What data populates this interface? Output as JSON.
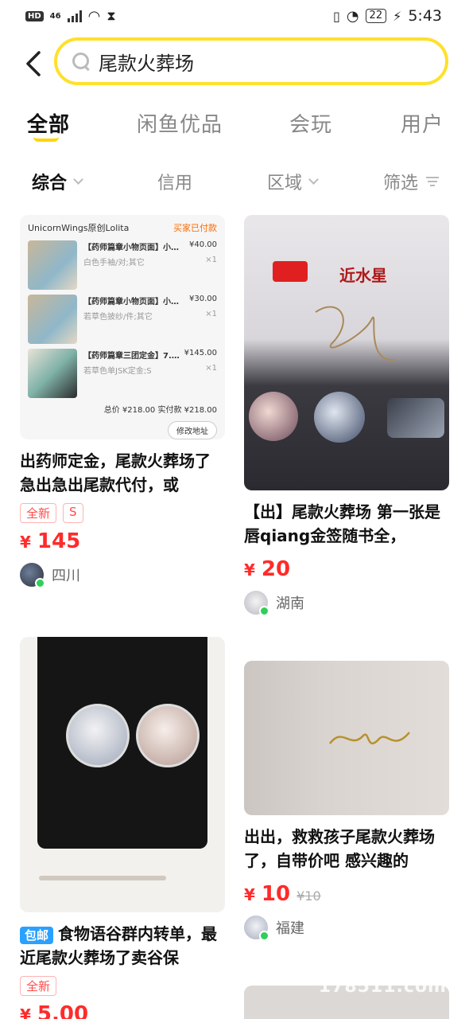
{
  "status_bar": {
    "hd": "HD",
    "network": "46",
    "battery": "22",
    "time": "5:43"
  },
  "search": {
    "back_icon": "chevron-left-icon",
    "query": "尾款火葬场",
    "border_color": "#ffe02b"
  },
  "tabs": [
    {
      "label": "全部",
      "active": true
    },
    {
      "label": "闲鱼优品",
      "active": false
    },
    {
      "label": "会玩",
      "active": false
    },
    {
      "label": "用户",
      "active": false
    }
  ],
  "filters": [
    {
      "label": "综合",
      "active": true
    },
    {
      "label": "信用",
      "active": false
    },
    {
      "label": "区域",
      "active": false
    },
    {
      "label": "筛选",
      "active": false
    }
  ],
  "cards": [
    {
      "order_shot": {
        "shop": "UnicornWings原创Lolita",
        "status": "买家已付款",
        "items": [
          {
            "name": "【药师篇章小物页面】小物/...",
            "price": "¥40.00",
            "spec": "白色手袖/对;其它",
            "qty": "×1"
          },
          {
            "name": "【药师篇章小物页面】小物/...",
            "price": "¥30.00",
            "spec": "若草色披纱/件;其它",
            "qty": "×1"
          },
          {
            "name": "【药师篇章三团定金】7.25...",
            "price": "¥145.00",
            "spec": "若草色单JSK定金;S",
            "qty": "×1"
          }
        ],
        "total": "总价 ¥218.00 实付款 ¥218.00",
        "button": "修改地址"
      },
      "title": "出药师定金，尾款火葬场了 急出急出尾款代付，或",
      "tags": [
        "全新",
        "S"
      ],
      "price": "145",
      "location": "四川"
    },
    {
      "image_text": "近水星",
      "title": "【出】尾款火葬场 第一张是唇qiang金签随书全，",
      "price": "20",
      "location": "湖南"
    },
    {
      "baoyou": "包邮",
      "title": "食物语谷群内转单，最近尾款火葬场了卖谷保",
      "tags": [
        "全新"
      ],
      "price": "5.00"
    },
    {
      "title": "出出，救救孩子尾款火葬场了，自带价吧 感兴趣的",
      "price": "10",
      "old_price": "¥10",
      "location": "福建"
    }
  ],
  "currency": "¥",
  "watermark": "178511.com"
}
